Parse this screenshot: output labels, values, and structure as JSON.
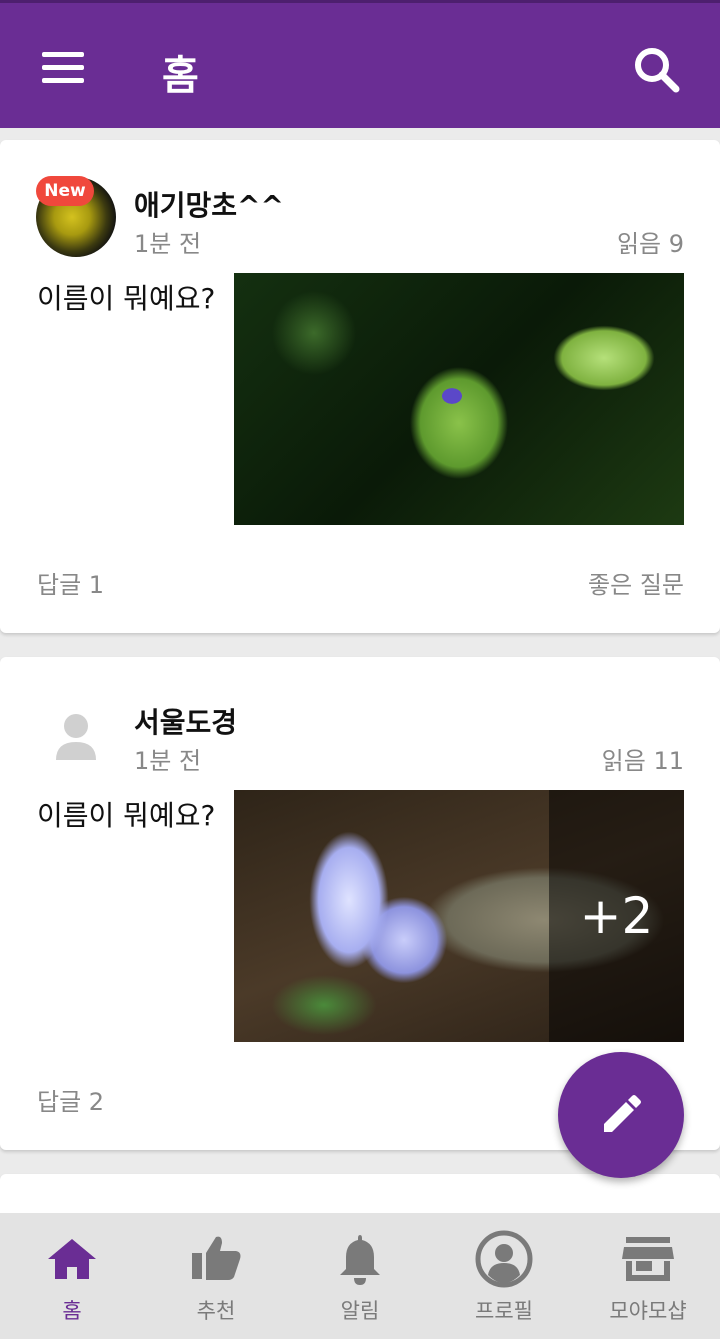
{
  "header": {
    "title": "홈",
    "bg_color": "#6a2d94"
  },
  "posts": [
    {
      "author": "애기망초^^",
      "badge": "New",
      "time": "1분 전",
      "reads": "읽음 9",
      "question": "이름이 뭐예요?",
      "replies": "답글 1",
      "action": "좋은 질문",
      "avatar": "flower-photo"
    },
    {
      "author": "서울도경",
      "time": "1분 전",
      "reads": "읽음 11",
      "question": "이름이 뭐예요?",
      "replies": "답글 2",
      "more_photos": "+2",
      "avatar": "default-person-icon"
    }
  ],
  "fab": {
    "icon": "pencil-icon"
  },
  "bottom_nav": {
    "active_color": "#6a2d94",
    "items": [
      {
        "label": "홈",
        "icon": "home-icon"
      },
      {
        "label": "추천",
        "icon": "thumbs-up-icon"
      },
      {
        "label": "알림",
        "icon": "bell-icon"
      },
      {
        "label": "프로필",
        "icon": "profile-icon"
      },
      {
        "label": "모야모샵",
        "icon": "store-icon"
      }
    ]
  }
}
